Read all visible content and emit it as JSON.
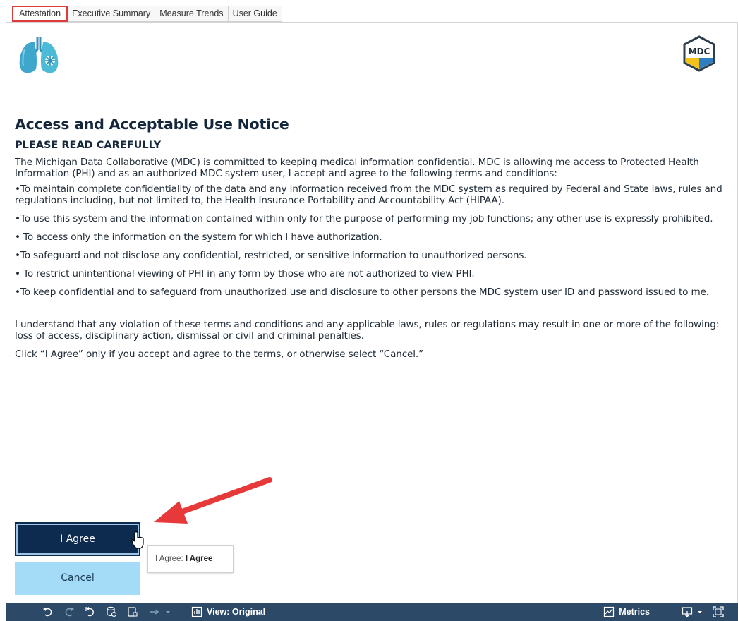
{
  "tabs": [
    {
      "label": "Attestation",
      "active": true
    },
    {
      "label": "Executive Summary",
      "active": false
    },
    {
      "label": "Measure Trends",
      "active": false
    },
    {
      "label": "User Guide",
      "active": false
    }
  ],
  "brand": {
    "mdc_logo_text": "MDC"
  },
  "notice": {
    "title": "Access and Acceptable Use Notice",
    "subtitle": "PLEASE READ CAREFULLY",
    "intro": "The Michigan Data Collaborative (MDC) is committed to keeping medical information confidential. MDC is allowing me access to Protected Health Information (PHI) and as an authorized MDC system user, I accept and agree to the following terms and conditions:",
    "terms": [
      "•To maintain complete confidentiality of the data and any information received from the MDC system as required by Federal and State laws, rules and regulations including, but not limited to, the Health Insurance Portability and Accountability Act (HIPAA).",
      "•To use this system and the information contained within only for the purpose of performing my job functions; any other use is expressly prohibited.",
      "• To access only the information on the system for which I have authorization.",
      "•To safeguard and not disclose any confidential, restricted, or sensitive information to unauthorized persons.",
      "• To restrict unintentional viewing of PHI in any form by those who are not authorized to view PHI.",
      "•To keep confidential and to safeguard from unauthorized use and disclosure to other persons the MDC system user ID and password issued to me."
    ],
    "violation": "I understand that any violation of these terms and conditions and any applicable laws, rules or regulations may result in one or more of the following: loss of access, disciplinary action, dismissal or civil and criminal penalties.",
    "instruction": "Click “I Agree” only if you accept and agree to the terms, or otherwise select “Cancel.”"
  },
  "buttons": {
    "agree": "I Agree",
    "cancel": "Cancel"
  },
  "tooltip": {
    "prefix": "I Agree: ",
    "value": "I Agree"
  },
  "toolbar": {
    "view_label": "View: Original",
    "metrics_label": "Metrics"
  },
  "colors": {
    "accent_highlight": "#e03a3a",
    "agree_button": "#0d2a4f",
    "cancel_button": "#a4dbf7",
    "toolbar_bg": "#2c4a68",
    "arrow": "#e8393a"
  }
}
